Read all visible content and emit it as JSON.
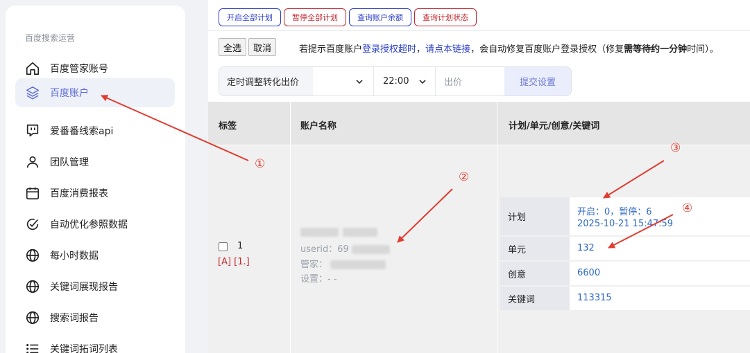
{
  "sidebar": {
    "section_title": "百度搜索运营",
    "items": [
      {
        "label": "百度管家账号",
        "icon": "home-icon"
      },
      {
        "label": "百度账户",
        "icon": "layers-icon"
      },
      {
        "label": "爱番番线索api",
        "icon": "chat-icon"
      },
      {
        "label": "团队管理",
        "icon": "user-icon"
      },
      {
        "label": "百度消费报表",
        "icon": "calendar-icon"
      },
      {
        "label": "自动优化参照数据",
        "icon": "check-circle-icon"
      },
      {
        "label": "每小时数据",
        "icon": "globe-icon"
      },
      {
        "label": "关键词展现报告",
        "icon": "globe-icon"
      },
      {
        "label": "搜索词报告",
        "icon": "globe-icon"
      },
      {
        "label": "关键词拓词列表",
        "icon": "list-icon"
      }
    ]
  },
  "toolbar": {
    "start_all": "开启全部计划",
    "pause_all": "暂停全部计划",
    "query_balance": "查询账户余额",
    "query_status": "查询计划状态",
    "select_all": "全选",
    "cancel": "取消"
  },
  "notice": {
    "p1": "若提示百度账户",
    "link1": "登录授权超时",
    "p2": "，",
    "link2": "请点本链接",
    "p3": "，会自动修复百度账户登录授权（修复",
    "bold1": "需等待约一分钟",
    "p4": "时间）。"
  },
  "schedule": {
    "label": "定时调整转化出价",
    "time_value": "22:00",
    "bid_placeholder": "出价",
    "submit": "提交设置"
  },
  "table": {
    "headers": [
      "标签",
      "账户名称",
      "计划/单元/创意/关键词"
    ],
    "row": {
      "index": "1",
      "tags": "[A] [1.]",
      "userid_label": "userid：",
      "userid_partial": "69",
      "manager_label": "管家：",
      "settings_label": "设置：",
      "settings_value": "- -",
      "stats": [
        {
          "label": "计划",
          "value_line1": "开启：0，暂停：6",
          "value_line2": "2025-10-21 15:47:59"
        },
        {
          "label": "单元",
          "value_line1": "132"
        },
        {
          "label": "创意",
          "value_line1": "6600"
        },
        {
          "label": "关键词",
          "value_line1": "113315"
        }
      ]
    }
  },
  "annotations": [
    "①",
    "②",
    "③",
    "④"
  ],
  "colors": {
    "accent": "#5b6bd8",
    "link": "#2f69c6",
    "annotation": "#e23b2f",
    "danger": "#c4262e",
    "primary_border": "#2b3cc9"
  }
}
